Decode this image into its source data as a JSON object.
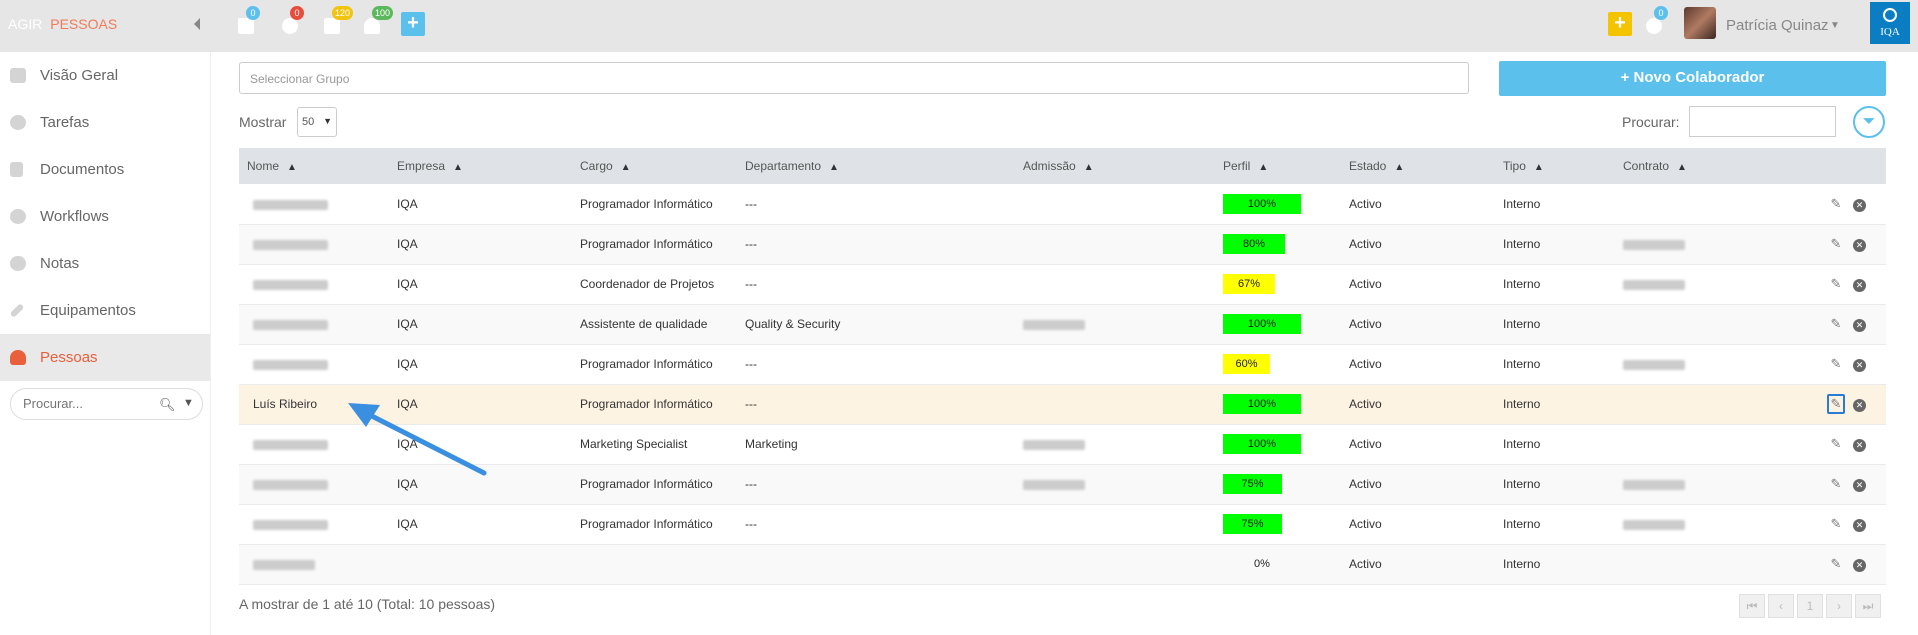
{
  "topbar": {
    "brand_agir": "AGIR",
    "brand_section": "PESSOAS",
    "badges": {
      "calendar": "0",
      "settings": "0",
      "documents": "120",
      "notifications": "100",
      "messages": "0"
    },
    "user_name": "Patrícia Quinaz",
    "logo_text": "IQA",
    "colors": {
      "badge_blue": "#5bc0ec",
      "badge_red": "#e74c3c",
      "badge_yellow": "#f1c40f",
      "badge_green": "#5cb85c",
      "plus_yellow": "#f5c400"
    }
  },
  "sidebar": {
    "items": [
      {
        "label": "Visão Geral",
        "icon": "home-icon"
      },
      {
        "label": "Tarefas",
        "icon": "gear-icon"
      },
      {
        "label": "Documentos",
        "icon": "document-icon"
      },
      {
        "label": "Workflows",
        "icon": "cogs-icon"
      },
      {
        "label": "Notas",
        "icon": "comments-icon"
      },
      {
        "label": "Equipamentos",
        "icon": "wrench-icon"
      },
      {
        "label": "Pessoas",
        "icon": "user-icon"
      }
    ],
    "search_placeholder": "Procurar..."
  },
  "main": {
    "group_placeholder": "Seleccionar Grupo",
    "new_button": "Novo Colaborador",
    "show_label": "Mostrar",
    "page_size": "50",
    "search_label": "Procurar:",
    "columns": [
      "Nome",
      "Empresa",
      "Cargo",
      "Departamento",
      "Admissão",
      "Perfil",
      "Estado",
      "Tipo",
      "Contrato"
    ],
    "rows": [
      {
        "nome": "",
        "empresa": "IQA",
        "cargo": "Programador Informático",
        "departamento": "---",
        "admissao": "",
        "perfil": "100%",
        "perfil_value": 100,
        "estado": "Activo",
        "tipo": "Interno",
        "contrato": ""
      },
      {
        "nome": "",
        "empresa": "IQA",
        "cargo": "Programador Informático",
        "departamento": "---",
        "admissao": "",
        "perfil": "80%",
        "perfil_value": 80,
        "estado": "Activo",
        "tipo": "Interno",
        "contrato": ""
      },
      {
        "nome": "",
        "empresa": "IQA",
        "cargo": "Coordenador de Projetos",
        "departamento": "---",
        "admissao": "",
        "perfil": "67%",
        "perfil_value": 67,
        "estado": "Activo",
        "tipo": "Interno",
        "contrato": ""
      },
      {
        "nome": "",
        "empresa": "IQA",
        "cargo": "Assistente de qualidade",
        "departamento": "Quality & Security",
        "admissao": "",
        "perfil": "100%",
        "perfil_value": 100,
        "estado": "Activo",
        "tipo": "Interno",
        "contrato": ""
      },
      {
        "nome": "",
        "empresa": "IQA",
        "cargo": "Programador Informático",
        "departamento": "---",
        "admissao": "",
        "perfil": "60%",
        "perfil_value": 60,
        "estado": "Activo",
        "tipo": "Interno",
        "contrato": ""
      },
      {
        "nome": "Luís Ribeiro",
        "empresa": "IQA",
        "cargo": "Programador Informático",
        "departamento": "---",
        "admissao": "",
        "perfil": "100%",
        "perfil_value": 100,
        "estado": "Activo",
        "tipo": "Interno",
        "contrato": ""
      },
      {
        "nome": "",
        "empresa": "IQA",
        "cargo": "Marketing Specialist",
        "departamento": "Marketing",
        "admissao": "",
        "perfil": "100%",
        "perfil_value": 100,
        "estado": "Activo",
        "tipo": "Interno",
        "contrato": ""
      },
      {
        "nome": "",
        "empresa": "IQA",
        "cargo": "Programador Informático",
        "departamento": "---",
        "admissao": "",
        "perfil": "75%",
        "perfil_value": 75,
        "estado": "Activo",
        "tipo": "Interno",
        "contrato": ""
      },
      {
        "nome": "",
        "empresa": "IQA",
        "cargo": "Programador Informático",
        "departamento": "---",
        "admissao": "",
        "perfil": "75%",
        "perfil_value": 75,
        "estado": "Activo",
        "tipo": "Interno",
        "contrato": ""
      },
      {
        "nome": "",
        "empresa": "",
        "cargo": "",
        "departamento": "",
        "admissao": "",
        "perfil": "0%",
        "perfil_value": 0,
        "estado": "Activo",
        "tipo": "Interno",
        "contrato": ""
      }
    ],
    "footer": "A mostrar de 1 até 10 (Total: 10 pessoas)",
    "pager_current": "1",
    "perfil_colors": {
      "high": "#00ff00",
      "mid": "#ffff00"
    }
  }
}
